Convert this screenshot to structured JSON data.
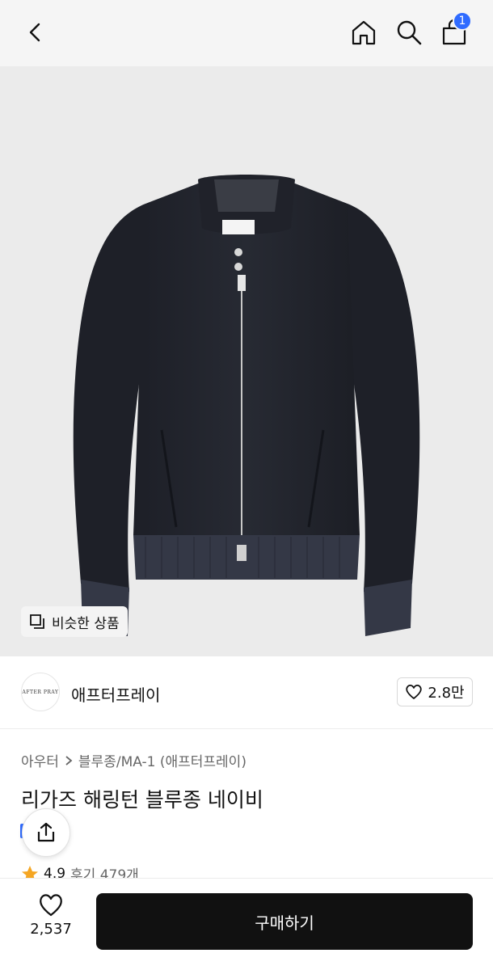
{
  "header": {
    "cart_count": "1",
    "icons": [
      "back-icon",
      "home-icon",
      "search-icon",
      "cart-icon"
    ]
  },
  "hero": {
    "similar_label": "비슷한 상품",
    "logo_text": "AFTER PRAY"
  },
  "brand": {
    "logo_text": "AFTER PRAY",
    "name": "애프터프레이",
    "likes": "2.8만"
  },
  "product": {
    "category": "아우터",
    "subcategory": "블루종/MA-1 (애프터프레이)",
    "title": "리가즈 해링턴 블루종 네이비",
    "rating": "4.9",
    "reviews": "후기 479개"
  },
  "bottom": {
    "wish_count": "2,537",
    "buy_label": "구매하기"
  },
  "colors": {
    "accent": "#2f6bff",
    "buy_button": "#111111",
    "star": "#f5a623",
    "jacket": "#23252d"
  }
}
